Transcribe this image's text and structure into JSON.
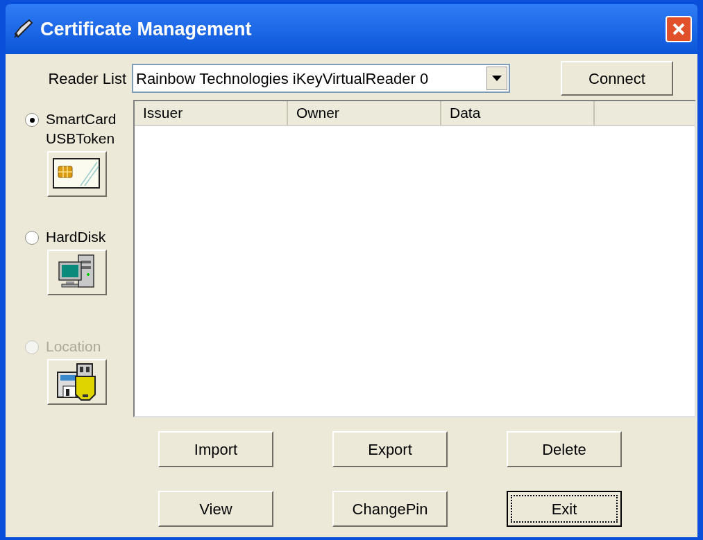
{
  "window": {
    "title": "Certificate Management"
  },
  "reader_list": {
    "label": "Reader List",
    "value": "Rainbow Technologies iKeyVirtualReader 0"
  },
  "connect_button": "Connect",
  "sources": [
    {
      "lines": [
        "SmartCard",
        "USBToken"
      ],
      "selected": true,
      "disabled": false,
      "kind": "card"
    },
    {
      "lines": [
        "HardDisk"
      ],
      "selected": false,
      "disabled": false,
      "kind": "computer"
    },
    {
      "lines": [
        "Location"
      ],
      "selected": false,
      "disabled": true,
      "kind": "removable"
    }
  ],
  "table": {
    "columns": [
      "Issuer",
      "Owner",
      "Data"
    ]
  },
  "buttons": [
    [
      {
        "label": "Import",
        "focused": false
      },
      {
        "label": "Export",
        "focused": false
      },
      {
        "label": "Delete",
        "focused": false
      }
    ],
    [
      {
        "label": "View",
        "focused": false
      },
      {
        "label": "ChangePin",
        "focused": false
      },
      {
        "label": "Exit",
        "focused": true
      }
    ]
  ]
}
